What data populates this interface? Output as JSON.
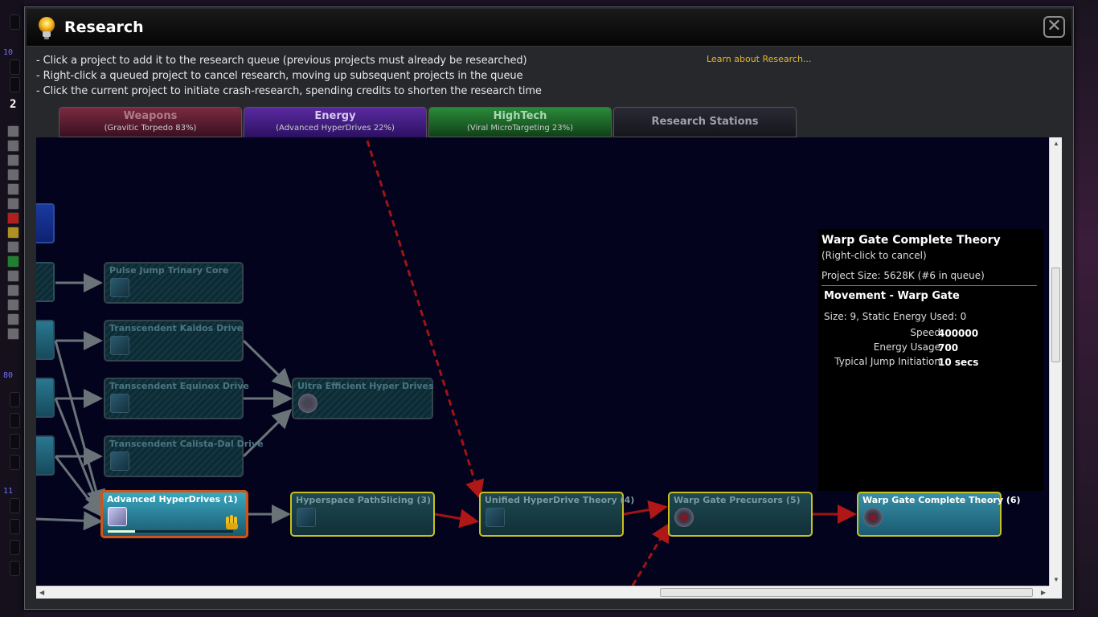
{
  "window": {
    "title": "Research",
    "close_label": "✕",
    "instructions": [
      "- Click a project to add it to the research queue (previous projects must already be researched)",
      "- Right-click a queued project to cancel research, moving up subsequent projects in the queue",
      "- Click the current project to initiate crash-research, spending credits to shorten the research time"
    ],
    "learn_link": "Learn about Research..."
  },
  "tabs": [
    {
      "name": "Weapons",
      "sub": "(Gravitic Torpedo  83%)",
      "color": "#7a2a40"
    },
    {
      "name": "Energy",
      "sub": "(Advanced HyperDrives  22%)",
      "color": "#5a2aa0",
      "selected": true
    },
    {
      "name": "HighTech",
      "sub": "(Viral MicroTargeting  23%)",
      "color": "#2a8a3a"
    },
    {
      "name": "Research Stations",
      "sub": "",
      "color": "#2a2a36"
    }
  ],
  "nodes": {
    "pulse_jump": "Pulse Jump Trinary Core",
    "kaldos": "Transcendent Kaldos Drive",
    "equinox": "Transcendent Equinox Drive",
    "calista": "Transcendent Calista-Dal Drive",
    "ultra": "Ultra Efficient Hyper Drives",
    "advanced": "Advanced HyperDrives (1)",
    "pathslicing": "Hyperspace PathSlicing (3)",
    "unified": "Unified HyperDrive Theory (4)",
    "precursors": "Warp Gate Precursors (5)",
    "complete": "Warp Gate Complete Theory (6)"
  },
  "current_progress": 0.22,
  "tooltip": {
    "title": "Warp Gate Complete Theory",
    "subtitle": "(Right-click to cancel)",
    "size": "Project Size: 5628K  (#6 in queue)",
    "section": "Movement - Warp Gate",
    "static": "Size: 9,  Static Energy Used: 0",
    "stats": [
      {
        "label": "Speed",
        "value": "400000"
      },
      {
        "label": "Energy Usage",
        "value": "700"
      },
      {
        "label": "Typical Jump Initiation",
        "value": "10 secs"
      }
    ]
  },
  "left_strip": {
    "numbers": [
      "10",
      "2",
      "80",
      "11"
    ]
  }
}
